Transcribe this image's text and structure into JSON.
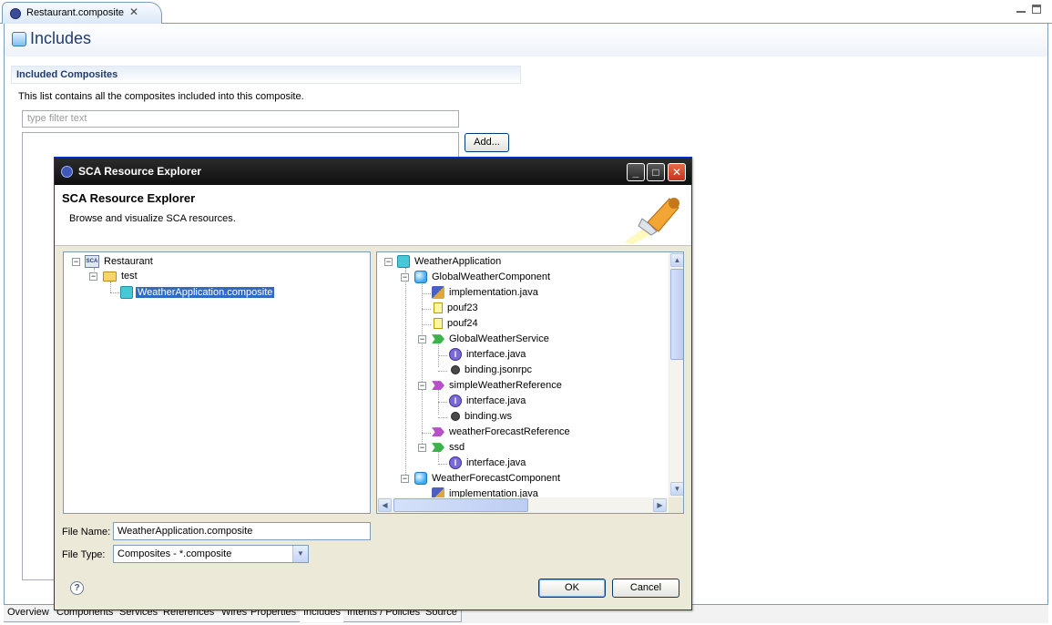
{
  "editor": {
    "tab_label": "Restaurant.composite",
    "tab_close": "✕",
    "page_title": "Includes",
    "section_title": "Included Composites",
    "section_description": "This list contains all the composites included into this composite.",
    "filter_placeholder": "type filter text",
    "add_button": "Add...",
    "bottom_tabs": [
      "Overview",
      "Components",
      "Services",
      "References",
      "Wires",
      "Properties",
      "Includes",
      "Intents / Policies",
      "Source"
    ],
    "active_bottom_tab": "Includes"
  },
  "dialog": {
    "title": "SCA Resource Explorer",
    "banner_title": "SCA Resource Explorer",
    "banner_description": "Browse and visualize SCA resources.",
    "left_tree": [
      {
        "label": "Restaurant",
        "icon": "sca-project-icon",
        "selected": false
      },
      {
        "label": "test",
        "icon": "folder-icon",
        "selected": false
      },
      {
        "label": "WeatherApplication.composite",
        "icon": "composite-file-icon",
        "selected": true
      }
    ],
    "right_tree": [
      {
        "label": "WeatherApplication",
        "icon": "composite-icon"
      },
      {
        "label": "GlobalWeatherComponent",
        "icon": "component-icon"
      },
      {
        "label": "implementation.java",
        "icon": "implementation-icon"
      },
      {
        "label": "pouf23",
        "icon": "property-icon"
      },
      {
        "label": "pouf24",
        "icon": "property-icon"
      },
      {
        "label": "GlobalWeatherService",
        "icon": "service-icon"
      },
      {
        "label": "interface.java",
        "icon": "interface-icon"
      },
      {
        "label": "binding.jsonrpc",
        "icon": "binding-icon"
      },
      {
        "label": "simpleWeatherReference",
        "icon": "reference-icon"
      },
      {
        "label": "interface.java",
        "icon": "interface-icon"
      },
      {
        "label": "binding.ws",
        "icon": "binding-icon"
      },
      {
        "label": "weatherForecastReference",
        "icon": "reference-icon"
      },
      {
        "label": "ssd",
        "icon": "service-icon"
      },
      {
        "label": "interface.java",
        "icon": "interface-icon"
      },
      {
        "label": "WeatherForecastComponent",
        "icon": "component-icon"
      },
      {
        "label": "implementation.java",
        "icon": "implementation-icon"
      }
    ],
    "file_name_label": "File Name:",
    "file_name_value": "WeatherApplication.composite",
    "file_type_label": "File Type:",
    "file_type_value": "Composites - *.composite",
    "ok_button": "OK",
    "cancel_button": "Cancel",
    "help_icon": "?"
  }
}
